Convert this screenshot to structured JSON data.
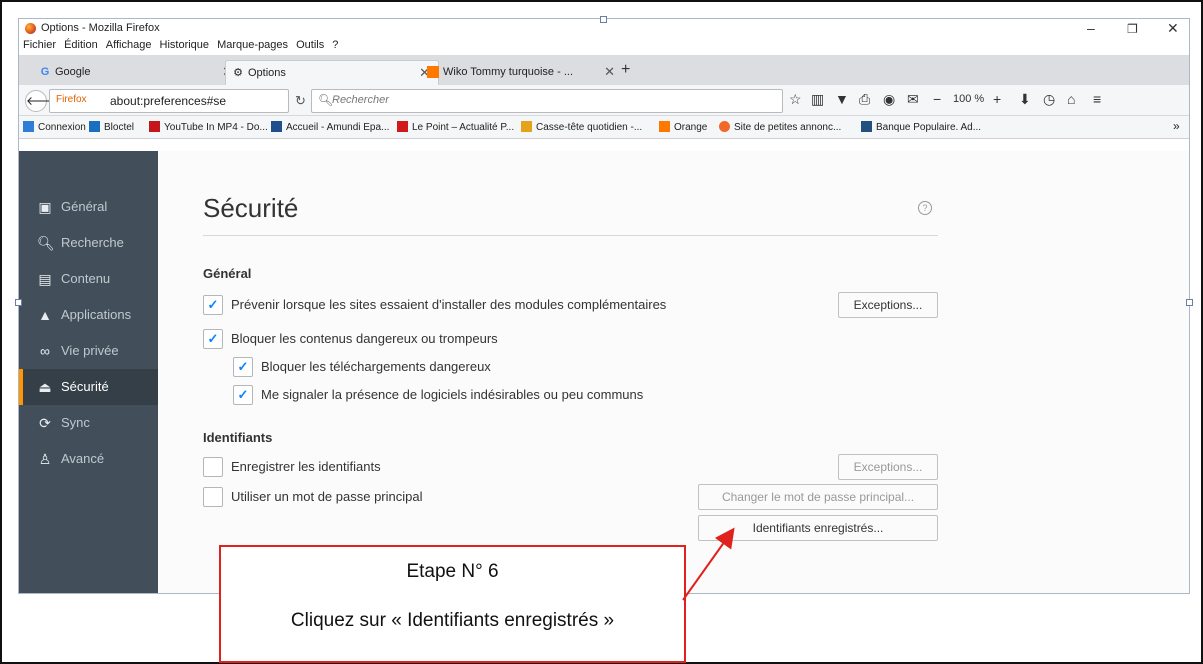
{
  "window": {
    "title": "Options - Mozilla Firefox"
  },
  "menubar": [
    "Fichier",
    "Édition",
    "Affichage",
    "Historique",
    "Marque-pages",
    "Outils",
    "?"
  ],
  "tabs": [
    {
      "label": "Google",
      "icon": "google-favicon"
    },
    {
      "label": "Options",
      "icon": "gear-icon"
    },
    {
      "label": "Wiko Tommy turquoise - ...",
      "icon": "orange-favicon"
    }
  ],
  "navbar": {
    "identity": "Firefox",
    "url": "about:preferences#se",
    "search_placeholder": "Rechercher",
    "zoom": "100 %"
  },
  "bookmarks": [
    {
      "label": "Connexion",
      "color": "#2e7dd7"
    },
    {
      "label": "Bloctel",
      "color": "#1a6fc0"
    },
    {
      "label": "YouTube In MP4 - Do...",
      "color": "#c4171b"
    },
    {
      "label": "Accueil - Amundi Epa...",
      "color": "#1f4f8c"
    },
    {
      "label": "Le Point – Actualité P...",
      "color": "#d0191c"
    },
    {
      "label": "Casse-tête quotidien -...",
      "color": "#e5a21b"
    },
    {
      "label": "Orange",
      "color": "#ff7900"
    },
    {
      "label": "Site de petites annonc...",
      "color": "#f2682a"
    },
    {
      "label": "Banque Populaire. Ad...",
      "color": "#23507c"
    }
  ],
  "sidebar": {
    "items": [
      {
        "label": "Général",
        "icon": "general-icon"
      },
      {
        "label": "Recherche",
        "icon": "search-icon"
      },
      {
        "label": "Contenu",
        "icon": "document-icon"
      },
      {
        "label": "Applications",
        "icon": "rocket-icon"
      },
      {
        "label": "Vie privée",
        "icon": "mask-icon"
      },
      {
        "label": "Sécurité",
        "icon": "lock-icon"
      },
      {
        "label": "Sync",
        "icon": "sync-icon"
      },
      {
        "label": "Avancé",
        "icon": "wizard-icon"
      }
    ],
    "selected": "Sécurité"
  },
  "main": {
    "title": "Sécurité",
    "general_heading": "Général",
    "opt_addons": "Prévenir lorsque les sites essaient d'installer des modules complémentaires",
    "opt_block": "Bloquer les contenus dangereux ou trompeurs",
    "opt_downloads": "Bloquer les téléchargements dangereux",
    "opt_unwanted": "Me signaler la présence de logiciels indésirables ou peu communs",
    "exceptions_label": "Exceptions...",
    "identifiants_heading": "Identifiants",
    "opt_save_logins": "Enregistrer les identifiants",
    "opt_master_pw": "Utiliser un mot de passe principal",
    "exceptions2_label": "Exceptions...",
    "change_master_label": "Changer le mot de passe principal...",
    "saved_logins_label": "Identifiants enregistrés..."
  },
  "annotation": {
    "step": "Etape N° 6",
    "instruction": "Cliquez sur « Identifiants enregistrés »",
    "border_color": "#e0221f"
  }
}
